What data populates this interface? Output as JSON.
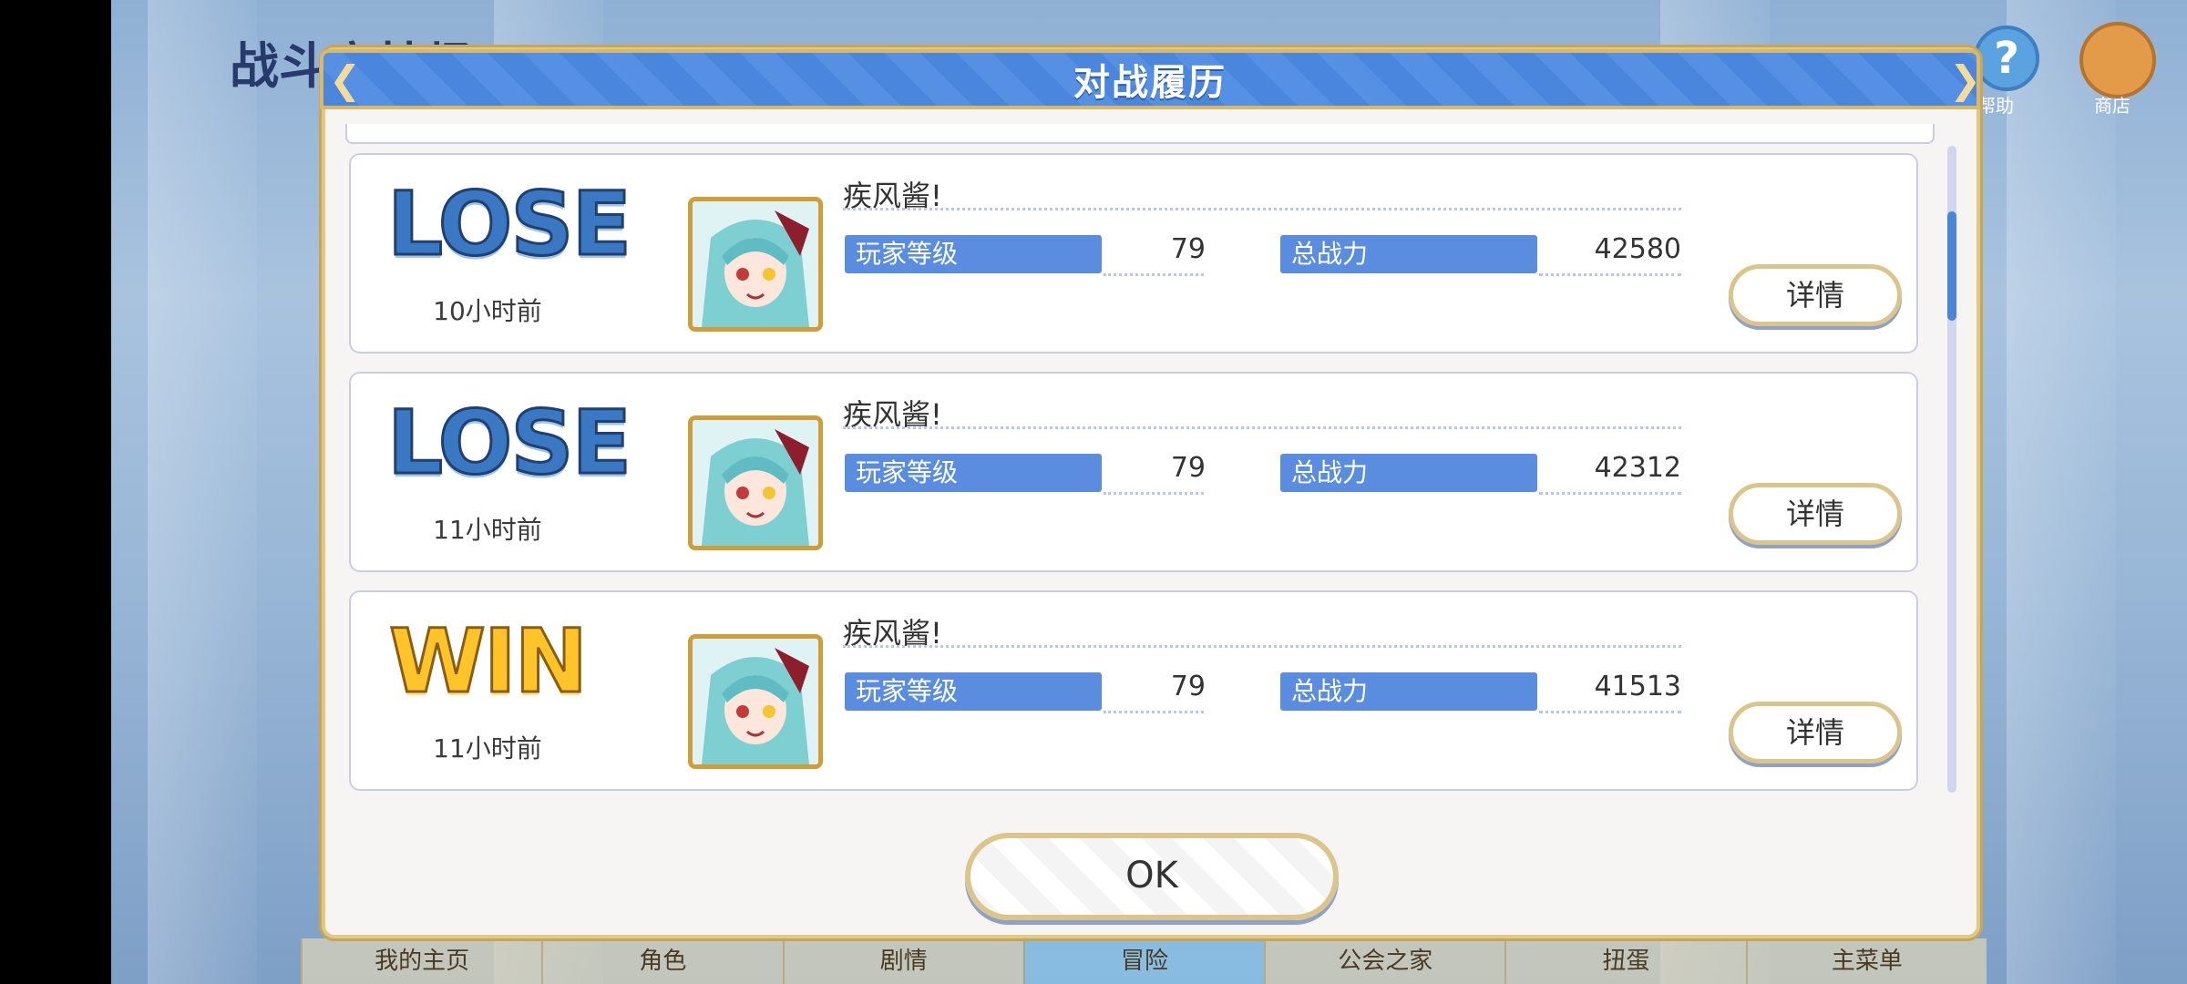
{
  "screen": {
    "title": "战斗竞技场",
    "help_label": "帮助",
    "shop_label": "商店"
  },
  "bottom_nav": [
    {
      "label": "我的主页"
    },
    {
      "label": "角色"
    },
    {
      "label": "剧情"
    },
    {
      "label": "冒险"
    },
    {
      "label": "公会之家"
    },
    {
      "label": "扭蛋"
    },
    {
      "label": "主菜单"
    }
  ],
  "modal": {
    "title": "对战履历",
    "ok_label": "OK",
    "rows": [
      {
        "result": "LOSE",
        "time": "10小时前",
        "opponent": "疾风酱!",
        "level_label": "玩家等级",
        "level": "79",
        "power_label": "总战力",
        "power": "42580",
        "detail_label": "详情"
      },
      {
        "result": "LOSE",
        "time": "11小时前",
        "opponent": "疾风酱!",
        "level_label": "玩家等级",
        "level": "79",
        "power_label": "总战力",
        "power": "42312",
        "detail_label": "详情"
      },
      {
        "result": "WIN",
        "time": "11小时前",
        "opponent": "疾风酱!",
        "level_label": "玩家等级",
        "level": "79",
        "power_label": "总战力",
        "power": "41513",
        "detail_label": "详情"
      }
    ]
  },
  "colors": {
    "header_blue": "#4b86de",
    "stat_label_blue": "#5a8de0",
    "gold_border": "#dcc58a",
    "lose_blue": "#3a78c4",
    "win_gold": "#ffc42a"
  },
  "icons": {
    "back": "back-arrow-icon",
    "help": "question-icon",
    "shop": "shop-character-icon",
    "avatar": "character-portrait-icon"
  }
}
